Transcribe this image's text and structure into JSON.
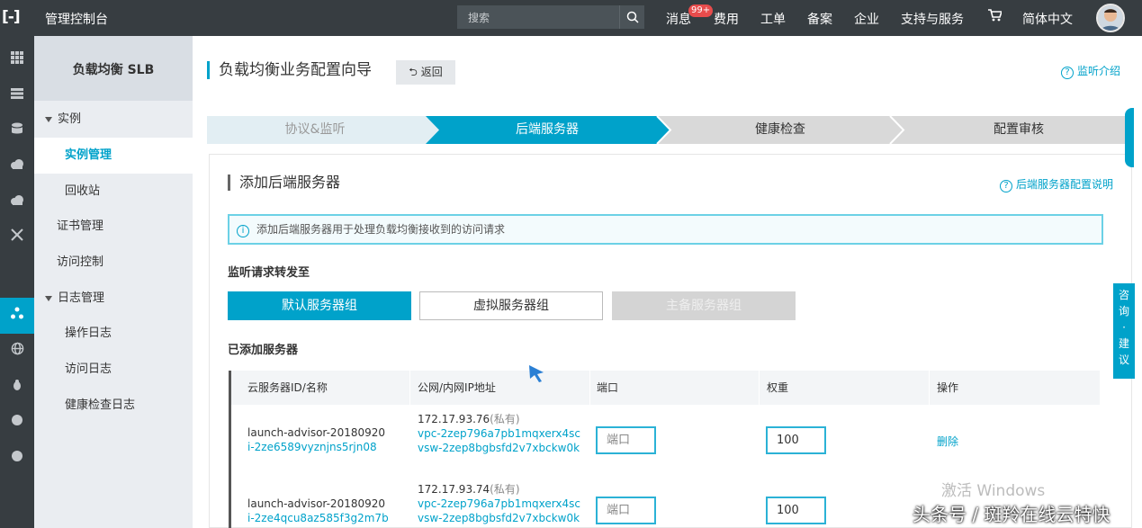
{
  "topbar": {
    "logo": "[-]",
    "console_title": "管理控制台",
    "search_placeholder": "搜索",
    "nav": [
      "消息",
      "费用",
      "工单",
      "备案",
      "企业",
      "支持与服务",
      "简体中文"
    ],
    "message_badge": "99+"
  },
  "sidebar": {
    "title": "负载均衡 SLB",
    "items": [
      {
        "label": "实例",
        "type": "group"
      },
      {
        "label": "实例管理",
        "type": "sub",
        "selected": true
      },
      {
        "label": "回收站",
        "type": "sub"
      },
      {
        "label": "证书管理",
        "type": "item"
      },
      {
        "label": "访问控制",
        "type": "item"
      },
      {
        "label": "日志管理",
        "type": "group"
      },
      {
        "label": "操作日志",
        "type": "sub"
      },
      {
        "label": "访问日志",
        "type": "sub"
      },
      {
        "label": "健康检查日志",
        "type": "sub"
      }
    ]
  },
  "main": {
    "title": "负载均衡业务配置向导",
    "back_label": "返回",
    "help_link": "监听介绍",
    "steps": [
      "协议&监听",
      "后端服务器",
      "健康检查",
      "配置审核"
    ],
    "active_step": 1,
    "panel": {
      "title": "添加后端服务器",
      "help_link": "后端服务器配置说明",
      "info": "添加后端服务器用于处理负载均衡接收到的访问请求",
      "forward_heading": "监听请求转发至",
      "group_buttons": [
        "默认服务器组",
        "虚拟服务器组",
        "主备服务器组"
      ],
      "added_heading": "已添加服务器",
      "table": {
        "headers": [
          "云服务器ID/名称",
          "公网/内网IP地址",
          "端口",
          "权重",
          "操作"
        ],
        "rows": [
          {
            "name": "launch-advisor-20180920",
            "id": "i-2ze6589vyznjns5rjn08",
            "ip": "172.17.93.76",
            "ip_tag": "(私有)",
            "vpc": "vpc-2zep796a7pb1mqxerx4sc",
            "vsw": "vsw-2zep8bgbsfd2v7xbckw0k",
            "port_placeholder": "端口",
            "weight": "100",
            "action": "删除"
          },
          {
            "name": "launch-advisor-20180920",
            "id": "i-2ze4qcu8az585f3g2m7b",
            "ip": "172.17.93.74",
            "ip_tag": "(私有)",
            "vpc": "vpc-2zep796a7pb1mqxerx4sc",
            "vsw": "vsw-2zep8bgbsfd2v7xbckw0k",
            "port_placeholder": "端口",
            "weight": "100",
            "action": ""
          }
        ]
      }
    }
  },
  "float_widget": {
    "label": "咨询·建议"
  },
  "watermarks": {
    "windows": "激活 Windows",
    "source": "头条号 / 斑羚在线云特快"
  },
  "colors": {
    "accent": "#00a2ca",
    "topbar": "#373d41",
    "sidebar": "#eaedf1",
    "step_inactive": "#d9d9d9",
    "disabled_button": "#d4d4d4"
  }
}
